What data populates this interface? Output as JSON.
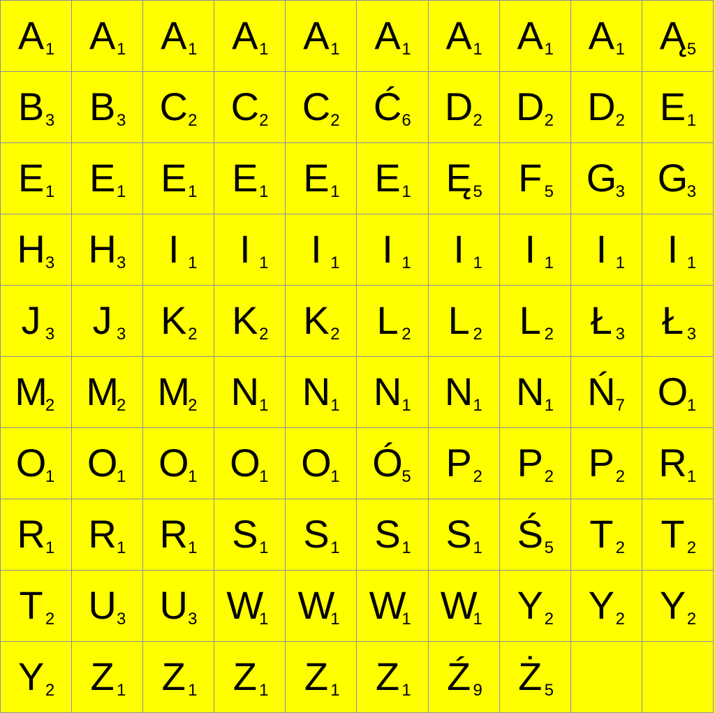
{
  "board": {
    "background_color": "#ffff00",
    "grid_line_color": "#8c8ca8",
    "text_color": "#000000",
    "tiles": [
      {
        "letter": "A",
        "points": "1"
      },
      {
        "letter": "A",
        "points": "1"
      },
      {
        "letter": "A",
        "points": "1"
      },
      {
        "letter": "A",
        "points": "1"
      },
      {
        "letter": "A",
        "points": "1"
      },
      {
        "letter": "A",
        "points": "1"
      },
      {
        "letter": "A",
        "points": "1"
      },
      {
        "letter": "A",
        "points": "1"
      },
      {
        "letter": "A",
        "points": "1"
      },
      {
        "letter": "Ą",
        "points": "5"
      },
      {
        "letter": "B",
        "points": "3"
      },
      {
        "letter": "B",
        "points": "3"
      },
      {
        "letter": "C",
        "points": "2"
      },
      {
        "letter": "C",
        "points": "2"
      },
      {
        "letter": "C",
        "points": "2"
      },
      {
        "letter": "Ć",
        "points": "6"
      },
      {
        "letter": "D",
        "points": "2"
      },
      {
        "letter": "D",
        "points": "2"
      },
      {
        "letter": "D",
        "points": "2"
      },
      {
        "letter": "E",
        "points": "1"
      },
      {
        "letter": "E",
        "points": "1"
      },
      {
        "letter": "E",
        "points": "1"
      },
      {
        "letter": "E",
        "points": "1"
      },
      {
        "letter": "E",
        "points": "1"
      },
      {
        "letter": "E",
        "points": "1"
      },
      {
        "letter": "E",
        "points": "1"
      },
      {
        "letter": "Ę",
        "points": "5"
      },
      {
        "letter": "F",
        "points": "5"
      },
      {
        "letter": "G",
        "points": "3"
      },
      {
        "letter": "G",
        "points": "3"
      },
      {
        "letter": "H",
        "points": "3"
      },
      {
        "letter": "H",
        "points": "3"
      },
      {
        "letter": "I",
        "points": "1"
      },
      {
        "letter": "I",
        "points": "1"
      },
      {
        "letter": "I",
        "points": "1"
      },
      {
        "letter": "I",
        "points": "1"
      },
      {
        "letter": "I",
        "points": "1"
      },
      {
        "letter": "I",
        "points": "1"
      },
      {
        "letter": "I",
        "points": "1"
      },
      {
        "letter": "I",
        "points": "1"
      },
      {
        "letter": "J",
        "points": "3"
      },
      {
        "letter": "J",
        "points": "3"
      },
      {
        "letter": "K",
        "points": "2"
      },
      {
        "letter": "K",
        "points": "2"
      },
      {
        "letter": "K",
        "points": "2"
      },
      {
        "letter": "L",
        "points": "2"
      },
      {
        "letter": "L",
        "points": "2"
      },
      {
        "letter": "L",
        "points": "2"
      },
      {
        "letter": "Ł",
        "points": "3"
      },
      {
        "letter": "Ł",
        "points": "3"
      },
      {
        "letter": "M",
        "points": "2"
      },
      {
        "letter": "M",
        "points": "2"
      },
      {
        "letter": "M",
        "points": "2"
      },
      {
        "letter": "N",
        "points": "1"
      },
      {
        "letter": "N",
        "points": "1"
      },
      {
        "letter": "N",
        "points": "1"
      },
      {
        "letter": "N",
        "points": "1"
      },
      {
        "letter": "N",
        "points": "1"
      },
      {
        "letter": "Ń",
        "points": "7"
      },
      {
        "letter": "O",
        "points": "1"
      },
      {
        "letter": "O",
        "points": "1"
      },
      {
        "letter": "O",
        "points": "1"
      },
      {
        "letter": "O",
        "points": "1"
      },
      {
        "letter": "O",
        "points": "1"
      },
      {
        "letter": "O",
        "points": "1"
      },
      {
        "letter": "Ó",
        "points": "5"
      },
      {
        "letter": "P",
        "points": "2"
      },
      {
        "letter": "P",
        "points": "2"
      },
      {
        "letter": "P",
        "points": "2"
      },
      {
        "letter": "R",
        "points": "1"
      },
      {
        "letter": "R",
        "points": "1"
      },
      {
        "letter": "R",
        "points": "1"
      },
      {
        "letter": "R",
        "points": "1"
      },
      {
        "letter": "S",
        "points": "1"
      },
      {
        "letter": "S",
        "points": "1"
      },
      {
        "letter": "S",
        "points": "1"
      },
      {
        "letter": "S",
        "points": "1"
      },
      {
        "letter": "Ś",
        "points": "5"
      },
      {
        "letter": "T",
        "points": "2"
      },
      {
        "letter": "T",
        "points": "2"
      },
      {
        "letter": "T",
        "points": "2"
      },
      {
        "letter": "U",
        "points": "3"
      },
      {
        "letter": "U",
        "points": "3"
      },
      {
        "letter": "W",
        "points": "1"
      },
      {
        "letter": "W",
        "points": "1"
      },
      {
        "letter": "W",
        "points": "1"
      },
      {
        "letter": "W",
        "points": "1"
      },
      {
        "letter": "Y",
        "points": "2"
      },
      {
        "letter": "Y",
        "points": "2"
      },
      {
        "letter": "Y",
        "points": "2"
      },
      {
        "letter": "Y",
        "points": "2"
      },
      {
        "letter": "Z",
        "points": "1"
      },
      {
        "letter": "Z",
        "points": "1"
      },
      {
        "letter": "Z",
        "points": "1"
      },
      {
        "letter": "Z",
        "points": "1"
      },
      {
        "letter": "Z",
        "points": "1"
      },
      {
        "letter": "Ź",
        "points": "9"
      },
      {
        "letter": "Ż",
        "points": "5"
      },
      {
        "letter": "",
        "points": ""
      },
      {
        "letter": "",
        "points": ""
      }
    ]
  }
}
